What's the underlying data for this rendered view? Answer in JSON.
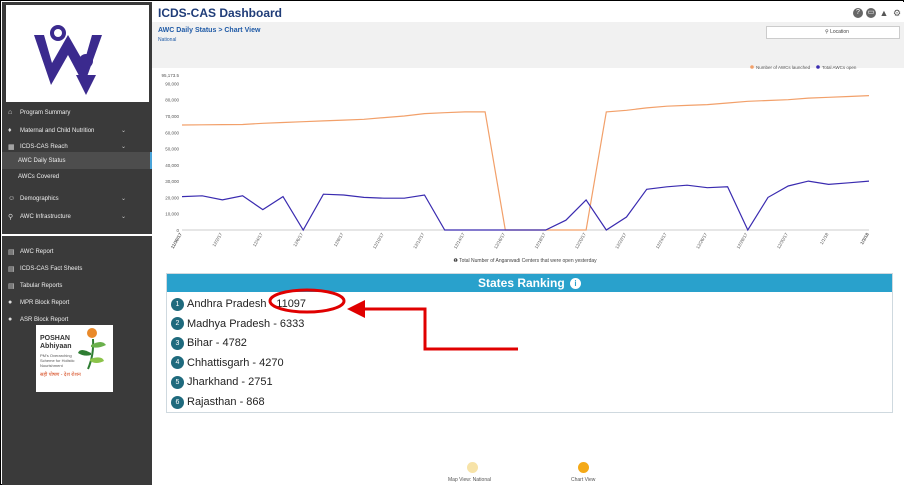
{
  "app": {
    "title": "ICDS-CAS Dashboard"
  },
  "header": {
    "breadcrumb_parent": "AWC Daily Status",
    "breadcrumb_separator": ">",
    "breadcrumb_current": "Chart View",
    "scope": "National",
    "location_button": "Location"
  },
  "toolbar_icons": [
    "help-icon",
    "print-icon",
    "alert-icon",
    "settings-icon"
  ],
  "sidebar": {
    "items": [
      {
        "label": "Program Summary",
        "icon": "home-icon",
        "expandable": false
      },
      {
        "label": "Maternal and Child Nutrition",
        "icon": "nutrition-icon",
        "expandable": true
      },
      {
        "label": "ICDS-CAS Reach",
        "icon": "chart-icon",
        "expandable": true
      },
      {
        "label": "AWC Daily Status",
        "icon": "",
        "expandable": false,
        "active": true
      },
      {
        "label": "AWCs Covered",
        "icon": "",
        "expandable": false
      },
      {
        "label": "Demographics",
        "icon": "people-icon",
        "expandable": true
      },
      {
        "label": "AWC Infrastructure",
        "icon": "pin-icon",
        "expandable": true
      }
    ],
    "reports": [
      {
        "label": "AWC Report",
        "icon": "report-icon"
      },
      {
        "label": "ICDS-CAS Fact Sheets",
        "icon": "report-icon"
      },
      {
        "label": "Tabular Reports",
        "icon": "report-icon"
      },
      {
        "label": "MPR Block Report",
        "icon": "user-icon"
      },
      {
        "label": "ASR Block Report",
        "icon": "user-icon"
      }
    ],
    "poshan": {
      "title_line1": "POSHAN",
      "title_line2": "Abhiyaan",
      "sub_line1": "PM's Overarching",
      "sub_line2": "Scheme for Holistic",
      "sub_line3": "Nourishment",
      "tagline": "सही पोषण - देश रोशन"
    }
  },
  "chart_data": {
    "type": "line",
    "ylim": [
      0,
      95173.5
    ],
    "ytick_labels": [
      "0",
      "10,000",
      "20,000",
      "30,000",
      "40,000",
      "50,000",
      "60,000",
      "70,000",
      "80,000",
      "90,000",
      "95,173.5"
    ],
    "x": [
      "11/30/17",
      "12/1/17",
      "12/2/17",
      "12/3/17",
      "12/4/17",
      "12/5/17",
      "12/6/17",
      "12/7/17",
      "12/8/17",
      "12/9/17",
      "12/10/17",
      "12/11/17",
      "12/12/17",
      "12/13/17",
      "12/14/17",
      "12/15/17",
      "12/16/17",
      "12/17/17",
      "12/18/17",
      "12/19/17",
      "12/20/17",
      "12/21/17",
      "12/22/17",
      "12/23/17",
      "12/24/17",
      "12/25/17",
      "12/26/17",
      "12/27/17",
      "12/28/17",
      "12/29/17",
      "12/30/17",
      "12/31/17",
      "1/1/18",
      "1/2/18",
      "1/3/18"
    ],
    "x_tick_labels": [
      "11/30/17",
      "12/2/17",
      "12/4/17",
      "12/6/17",
      "12/8/17",
      "12/10/17",
      "12/12/17",
      "12/14/17",
      "12/16/17",
      "12/18/17",
      "12/20/17",
      "12/22/17",
      "12/24/17",
      "12/26/17",
      "12/28/17",
      "12/30/17",
      "1/1/18",
      "1/3/18"
    ],
    "series": [
      {
        "name": "Number of AWCs launched",
        "color": "#f2a06a",
        "values": [
          64500,
          64600,
          64700,
          64800,
          65500,
          66000,
          66500,
          67000,
          67500,
          68000,
          69000,
          70000,
          71500,
          72000,
          72500,
          72600,
          0,
          0,
          0,
          0,
          0,
          72500,
          73500,
          75000,
          76000,
          76500,
          77000,
          78000,
          79000,
          79500,
          80000,
          81000,
          81500,
          82000,
          82500
        ]
      },
      {
        "name": "Total AWCs open",
        "color": "#3a2bb0",
        "values": [
          20500,
          21000,
          18500,
          21000,
          12500,
          20500,
          0,
          22000,
          21500,
          20000,
          19500,
          19500,
          21500,
          0,
          0,
          0,
          0,
          0,
          0,
          6000,
          18500,
          0,
          8000,
          25000,
          26500,
          27500,
          26000,
          26500,
          0,
          20000,
          27000,
          30000,
          28000,
          29000,
          30000
        ]
      }
    ],
    "xlabel": "Total Number of Anganwadi Centers that were open yesterday",
    "legend_position": "top-right"
  },
  "ranking": {
    "title": "States Ranking",
    "info_icon": "info-icon",
    "rows": [
      {
        "rank": "1",
        "state": "Andhra Pradesh",
        "value": "11097"
      },
      {
        "rank": "2",
        "state": "Madhya Pradesh",
        "value": "6333"
      },
      {
        "rank": "3",
        "state": "Bihar",
        "value": "4782"
      },
      {
        "rank": "4",
        "state": "Chhattisgarh",
        "value": "4270"
      },
      {
        "rank": "5",
        "state": "Jharkhand",
        "value": "2751"
      },
      {
        "rank": "6",
        "state": "Rajasthan",
        "value": "868"
      }
    ]
  },
  "views": [
    {
      "label": "Map View: National",
      "color": "#f7e3a8"
    },
    {
      "label": "Chart View",
      "color": "#f4a917"
    }
  ],
  "annotation_color": "#e00000"
}
